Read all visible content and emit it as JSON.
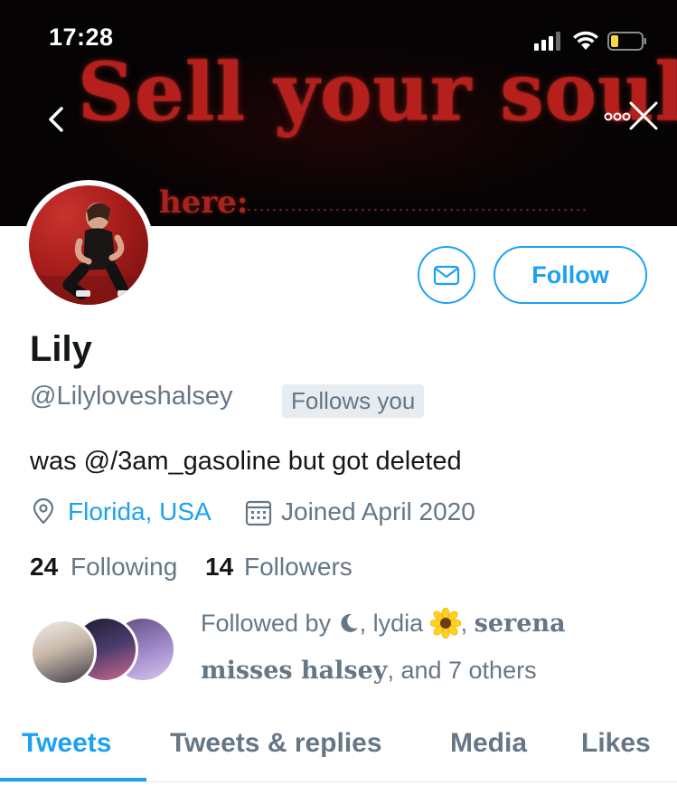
{
  "status_bar": {
    "time": "17:28"
  },
  "banner": {
    "line1": "Sell your soul",
    "line2": "here:"
  },
  "profile": {
    "display_name": "Lily",
    "handle": "@Lilyloveshalsey",
    "follows_you_badge": "Follows you",
    "bio": "was @/3am_gasoline but got deleted",
    "location": "Florida, USA",
    "joined": "Joined April 2020",
    "following_count": "24",
    "following_label": "Following",
    "followers_count": "14",
    "followers_label": "Followers"
  },
  "actions": {
    "follow_label": "Follow"
  },
  "followed_by": {
    "prefix": "Followed by ",
    "name2": "lydia",
    "comma": ", ",
    "name3_part1": "serena",
    "name3_part2": "misses halsey",
    "suffix": ", and 7 others"
  },
  "tabs": [
    {
      "label": "Tweets"
    },
    {
      "label": "Tweets & replies"
    },
    {
      "label": "Media"
    },
    {
      "label": "Likes"
    }
  ],
  "colors": {
    "accent": "#1da1f2",
    "secondary_text": "#657786",
    "primary_text": "#14171a",
    "banner_text": "#b5201c"
  }
}
